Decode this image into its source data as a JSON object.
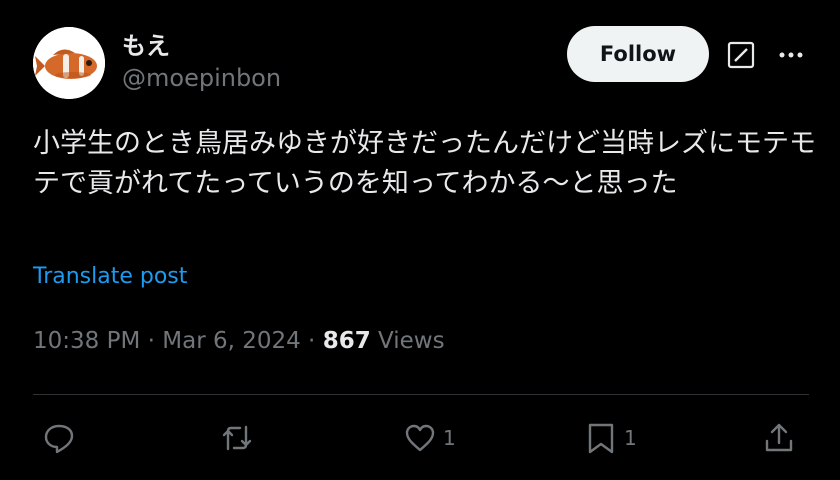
{
  "author": {
    "display_name": "もえ",
    "handle": "@moepinbon"
  },
  "header": {
    "follow_label": "Follow"
  },
  "tweet": {
    "text": "小学生のとき鳥居みゆきが好きだったんだけど当時レズにモテモテで貢がれてたっていうのを知ってわかる〜と思った",
    "translate_label": "Translate post"
  },
  "meta": {
    "time": "10:38 PM",
    "separator": " · ",
    "date": "Mar 6, 2024",
    "views_count": "867",
    "views_label": "Views"
  },
  "actions": {
    "reply_count": "",
    "retweet_count": "",
    "like_count": "1",
    "bookmark_count": "1"
  },
  "icons": {
    "avatar": "clownfish-avatar",
    "grok": "grok-icon",
    "more": "more-icon",
    "reply": "reply-icon",
    "retweet": "retweet-icon",
    "like": "heart-icon",
    "bookmark": "bookmark-icon",
    "share": "share-icon"
  },
  "colors": {
    "background": "#000000",
    "text_primary": "#e7e9ea",
    "text_secondary": "#71767b",
    "link": "#1d9bf0",
    "follow_bg": "#eff3f4",
    "divider": "#2f3336"
  }
}
